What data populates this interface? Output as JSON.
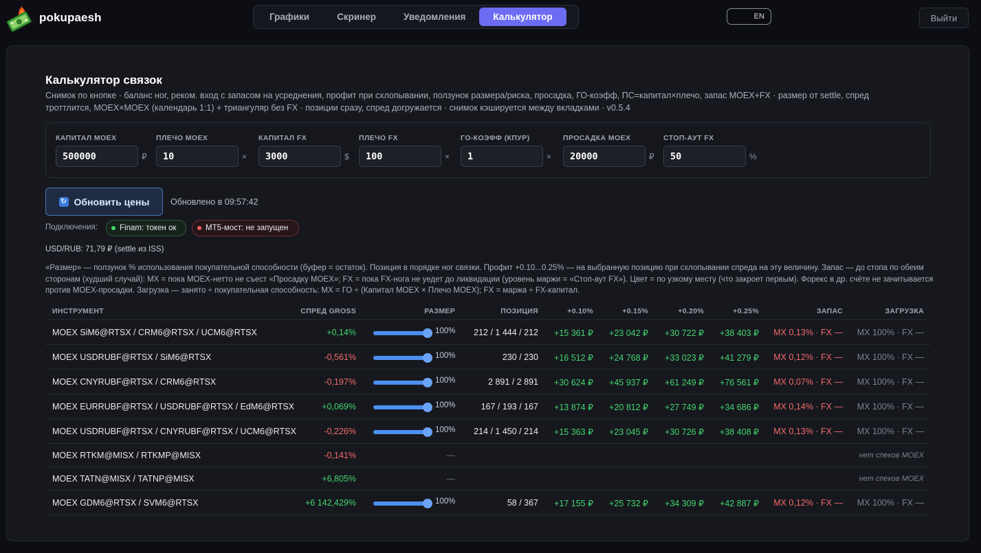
{
  "app": {
    "brand": "pokupaesh"
  },
  "nav": {
    "tabs": [
      "Графики",
      "Скринер",
      "Уведомления",
      "Калькулятор"
    ],
    "active": "Калькулятор"
  },
  "lang": {
    "label": "EN"
  },
  "logout_label": "Выйти",
  "page": {
    "title": "Калькулятор связок",
    "subtitle": "Снимок по кнопке · баланс ног, реком. вход с запасом на усреднения, профит при схлопывании, ползунок размера/риска, просадка, ГО-коэфф, ПС=капитал×плечо, запас MOEX+FX · размер от settle, спред троттлится, MOEX×MOEX (календарь 1:1) + триангуляр без FX · позиции сразу, спред догружается · снимок кэшируется между вкладками · v0.5.4"
  },
  "params": [
    {
      "label": "КАПИТАЛ MOEX",
      "value": "500000",
      "unit": "₽"
    },
    {
      "label": "ПЛЕЧО MOEX",
      "value": "10",
      "unit": "×"
    },
    {
      "label": "КАПИТАЛ FX",
      "value": "3000",
      "unit": "$"
    },
    {
      "label": "ПЛЕЧО FX",
      "value": "100",
      "unit": "×"
    },
    {
      "label": "ГО-КОЭФФ (КПУР)",
      "value": "1",
      "unit": "×"
    },
    {
      "label": "ПРОСАДКА MOEX",
      "value": "20000",
      "unit": "₽"
    },
    {
      "label": "СТОП-АУТ FX",
      "value": "50",
      "unit": "%"
    }
  ],
  "refresh": {
    "label": "Обновить цены",
    "updated": "Обновлено в 09:57:42"
  },
  "connections": {
    "label": "Подключения:",
    "finam": "Finam: токен ок",
    "mt5": "MT5-мост: не запущен"
  },
  "usdrub": "USD/RUB: 71,79 ₽ (settle из ISS)",
  "help_text": "«Размер» — ползунок % использования покупательной способности (буфер = остаток). Позиция в порядке ног связки. Профит +0.10...0.25% — на выбранную позицию при схлопывании спреда на эту величину. Запас — до стопа по обеим сторонам (худший случай): MX = пока MOEX-нетто не съест «Просадку MOEX»; FX = пока FX-нога не уедет до ликвидации (уровень маржи = «Стоп-аут FX»). Цвет = по узкому месту (что закроет первым). Форекс в др. счёте не зачитывается против MOEX-просадки. Загрузка — занято ÷ покупательная способность: MX = ГО ÷ (Капитал MOEX × Плечо MOEX); FX = маржа ÷ FX-капитал.",
  "table": {
    "headers": [
      "ИНСТРУМЕНТ",
      "СПРЕД GROSS",
      "РАЗМЕР",
      "ПОЗИЦИЯ",
      "+0.10%",
      "+0.15%",
      "+0.20%",
      "+0.25%",
      "ЗАПАС",
      "ЗАГРУЗКА"
    ],
    "rows": [
      {
        "instrument": "MOEX SiM6@RTSX / CRM6@RTSX / UCM6@RTSX",
        "spread": "+0,14%",
        "spread_sign": "pos",
        "size": "100%",
        "size_fraction": 1.0,
        "position": "212 / 1 444 / 212",
        "p10": "+15 361 ₽",
        "p15": "+23 042 ₽",
        "p20": "+30 722 ₽",
        "p25": "+38 403 ₽",
        "reserve": "MX 0,13% · FX —",
        "load": "MX 100% · FX —",
        "note": ""
      },
      {
        "instrument": "MOEX USDRUBF@RTSX / SiM6@RTSX",
        "spread": "-0,561%",
        "spread_sign": "neg",
        "size": "100%",
        "size_fraction": 1.0,
        "position": "230 / 230",
        "p10": "+16 512 ₽",
        "p15": "+24 768 ₽",
        "p20": "+33 023 ₽",
        "p25": "+41 279 ₽",
        "reserve": "MX 0,12% · FX —",
        "load": "MX 100% · FX —",
        "note": ""
      },
      {
        "instrument": "MOEX CNYRUBF@RTSX / CRM6@RTSX",
        "spread": "-0,197%",
        "spread_sign": "neg",
        "size": "100%",
        "size_fraction": 1.0,
        "position": "2 891 / 2 891",
        "p10": "+30 624 ₽",
        "p15": "+45 937 ₽",
        "p20": "+61 249 ₽",
        "p25": "+76 561 ₽",
        "reserve": "MX 0,07% · FX —",
        "load": "MX 100% · FX —",
        "note": ""
      },
      {
        "instrument": "MOEX EURRUBF@RTSX / USDRUBF@RTSX / EdM6@RTSX",
        "spread": "+0,069%",
        "spread_sign": "pos",
        "size": "100%",
        "size_fraction": 1.0,
        "position": "167 / 193 / 167",
        "p10": "+13 874 ₽",
        "p15": "+20 812 ₽",
        "p20": "+27 749 ₽",
        "p25": "+34 686 ₽",
        "reserve": "MX 0,14% · FX —",
        "load": "MX 100% · FX —",
        "note": ""
      },
      {
        "instrument": "MOEX USDRUBF@RTSX / CNYRUBF@RTSX / UCM6@RTSX",
        "spread": "-0,226%",
        "spread_sign": "neg",
        "size": "100%",
        "size_fraction": 1.0,
        "position": "214 / 1 450 / 214",
        "p10": "+15 363 ₽",
        "p15": "+23 045 ₽",
        "p20": "+30 726 ₽",
        "p25": "+38 408 ₽",
        "reserve": "MX 0,13% · FX —",
        "load": "MX 100% · FX —",
        "note": ""
      },
      {
        "instrument": "MOEX RTKM@MISX / RTKMP@MISX",
        "spread": "-0,141%",
        "spread_sign": "neg",
        "size": "—",
        "size_fraction": null,
        "position": "",
        "p10": "",
        "p15": "",
        "p20": "",
        "p25": "",
        "reserve": "",
        "load": "",
        "note": "нет спеков MOEX"
      },
      {
        "instrument": "MOEX TATN@MISX / TATNP@MISX",
        "spread": "+6,805%",
        "spread_sign": "pos",
        "size": "—",
        "size_fraction": null,
        "position": "",
        "p10": "",
        "p15": "",
        "p20": "",
        "p25": "",
        "reserve": "",
        "load": "",
        "note": "нет спеков MOEX"
      },
      {
        "instrument": "MOEX GDM6@RTSX / SVM6@RTSX",
        "spread": "+6 142,429%",
        "spread_sign": "pos",
        "size": "100%",
        "size_fraction": 1.0,
        "position": "58 / 367",
        "p10": "+17 155 ₽",
        "p15": "+25 732 ₽",
        "p20": "+34 309 ₽",
        "p25": "+42 887 ₽",
        "reserve": "MX 0,12% · FX —",
        "load": "MX 100% · FX —",
        "note": ""
      }
    ]
  }
}
